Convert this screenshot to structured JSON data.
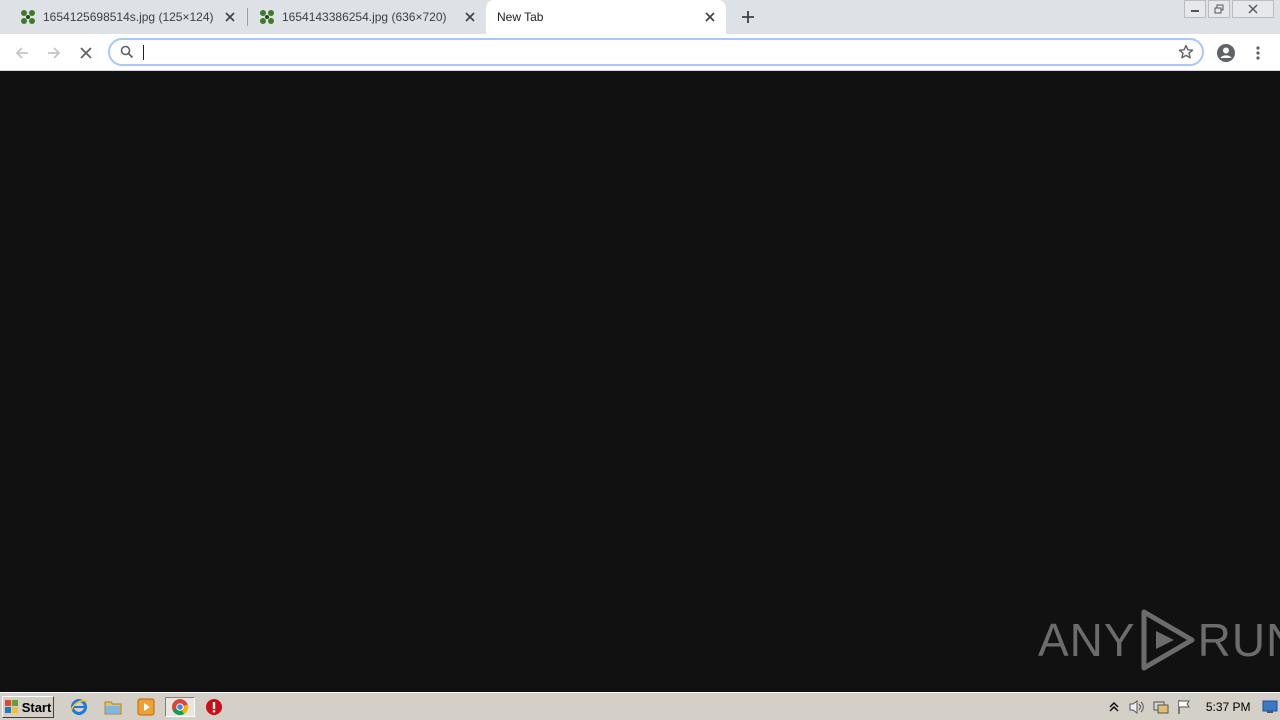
{
  "browser": {
    "tabs": [
      {
        "title": "1654125698514s.jpg (125×124)",
        "active": false
      },
      {
        "title": "1654143386254.jpg (636×720)",
        "active": false
      },
      {
        "title": "New Tab",
        "active": true
      }
    ],
    "omnibox": {
      "value": "",
      "placeholder": ""
    }
  },
  "content": {
    "background_color": "#111111",
    "watermark": {
      "left": "ANY",
      "right": "RUN"
    }
  },
  "taskbar": {
    "start_label": "Start",
    "pinned_icons": [
      "internet-explorer-icon",
      "file-explorer-icon",
      "media-player-icon",
      "chrome-icon",
      "opera-icon"
    ],
    "tray_icons": [
      "show-hidden-icons-icon",
      "volume-icon",
      "network-icon",
      "action-center-flag-icon"
    ],
    "clock": "5:37 PM"
  }
}
